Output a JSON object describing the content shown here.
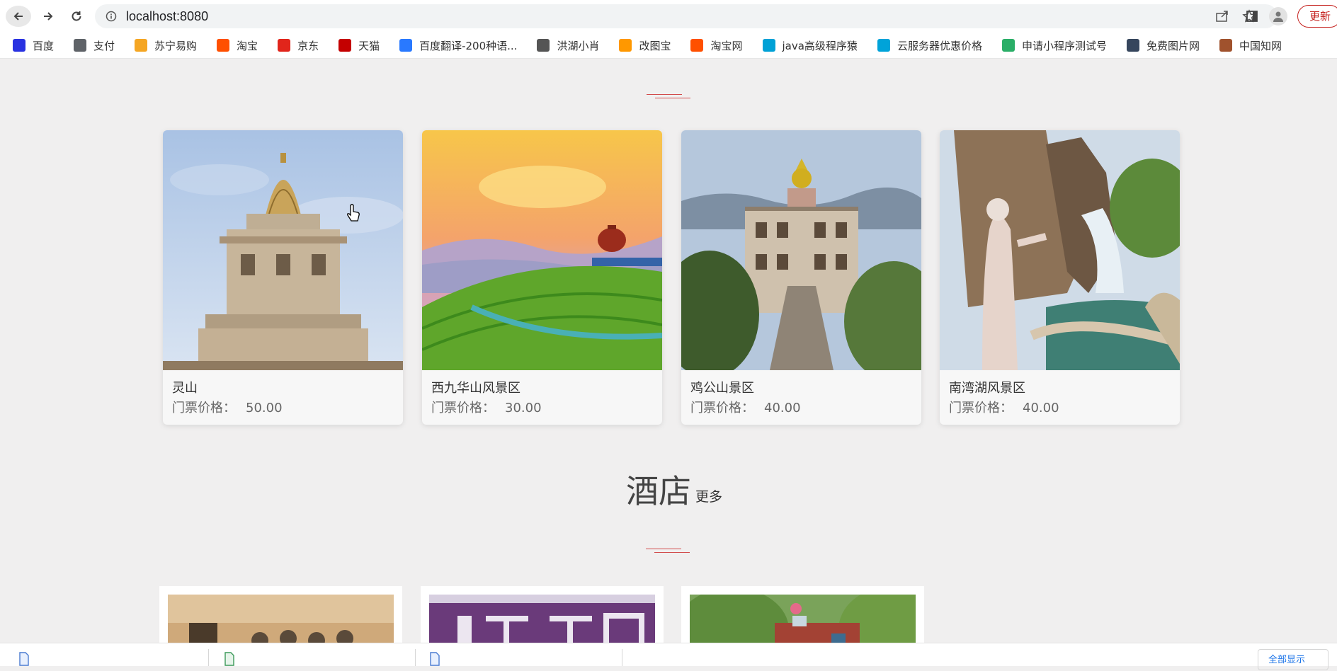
{
  "browser": {
    "url": "localhost:8080",
    "update_label": "更新"
  },
  "bookmarks": [
    {
      "label": "百度",
      "icon": "baidu-paw-icon",
      "color": "#2932e1"
    },
    {
      "label": "支付",
      "icon": "globe-icon",
      "color": "#5f6368"
    },
    {
      "label": "苏宁易购",
      "icon": "suning-icon",
      "color": "#f5a623"
    },
    {
      "label": "淘宝",
      "icon": "taobao-icon",
      "color": "#ff5000"
    },
    {
      "label": "京东",
      "icon": "jd-icon",
      "color": "#e1251b"
    },
    {
      "label": "天猫",
      "icon": "tmall-icon",
      "color": "#c40000"
    },
    {
      "label": "百度翻译-200种语...",
      "icon": "translate-icon",
      "color": "#2979ff"
    },
    {
      "label": "洪湖小肖",
      "icon": "bird-icon",
      "color": "#555555"
    },
    {
      "label": "改图宝",
      "icon": "gaitubao-icon",
      "color": "#ff9800"
    },
    {
      "label": "淘宝网",
      "icon": "taobao-net-icon",
      "color": "#ff5000"
    },
    {
      "label": "java高级程序猿",
      "icon": "bilibili-icon",
      "color": "#00a1d6"
    },
    {
      "label": "云服务器优惠价格",
      "icon": "cloud-icon",
      "color": "#00a3d9"
    },
    {
      "label": "申请小程序测试号",
      "icon": "wechat-icon",
      "color": "#2aae67"
    },
    {
      "label": "免费图片网",
      "icon": "tumblr-icon",
      "color": "#36465d"
    },
    {
      "label": "中国知网",
      "icon": "cnki-icon",
      "color": "#a0522d"
    }
  ],
  "attractions": [
    {
      "name": "灵山",
      "price_label": "门票价格：",
      "price": "50.00"
    },
    {
      "name": "西九华山风景区",
      "price_label": "门票价格：",
      "price": "30.00"
    },
    {
      "name": "鸡公山景区",
      "price_label": "门票价格：",
      "price": "40.00"
    },
    {
      "name": "南湾湖风景区",
      "price_label": "门票价格：",
      "price": "40.00"
    }
  ],
  "hotel_section": {
    "title": "酒店",
    "more_label": "更多"
  },
  "downloads": {
    "show_all_label": "全部显示"
  },
  "colors": {
    "accent_red": "#d24b4b",
    "page_bg": "#f0efef"
  }
}
